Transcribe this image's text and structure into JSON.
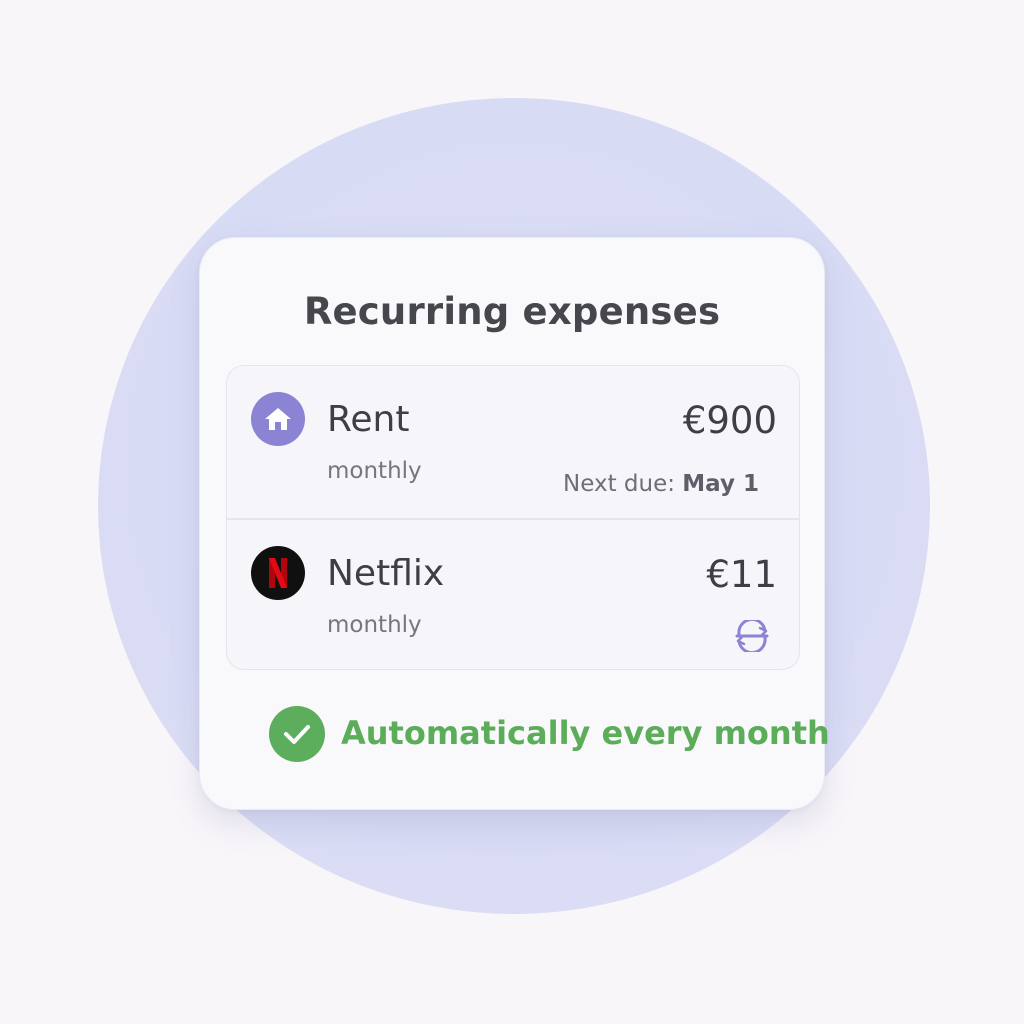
{
  "card": {
    "title": "Recurring expenses"
  },
  "expenses": [
    {
      "name": "Rent",
      "frequency": "monthly",
      "amount": "€900",
      "icon": "house-icon",
      "next_due_label": "Next due:",
      "next_due_date": "May 1"
    },
    {
      "name": "Netflix",
      "frequency": "monthly",
      "amount": "€11",
      "icon": "netflix-logo-icon",
      "status_icon": "sync-icon"
    }
  ],
  "footer": {
    "status_text": "Automatically every month",
    "status_icon": "check-circle-icon"
  },
  "colors": {
    "accent_purple": "#8b83d3",
    "success_green": "#5cae5c",
    "netflix_red": "#e50914"
  }
}
